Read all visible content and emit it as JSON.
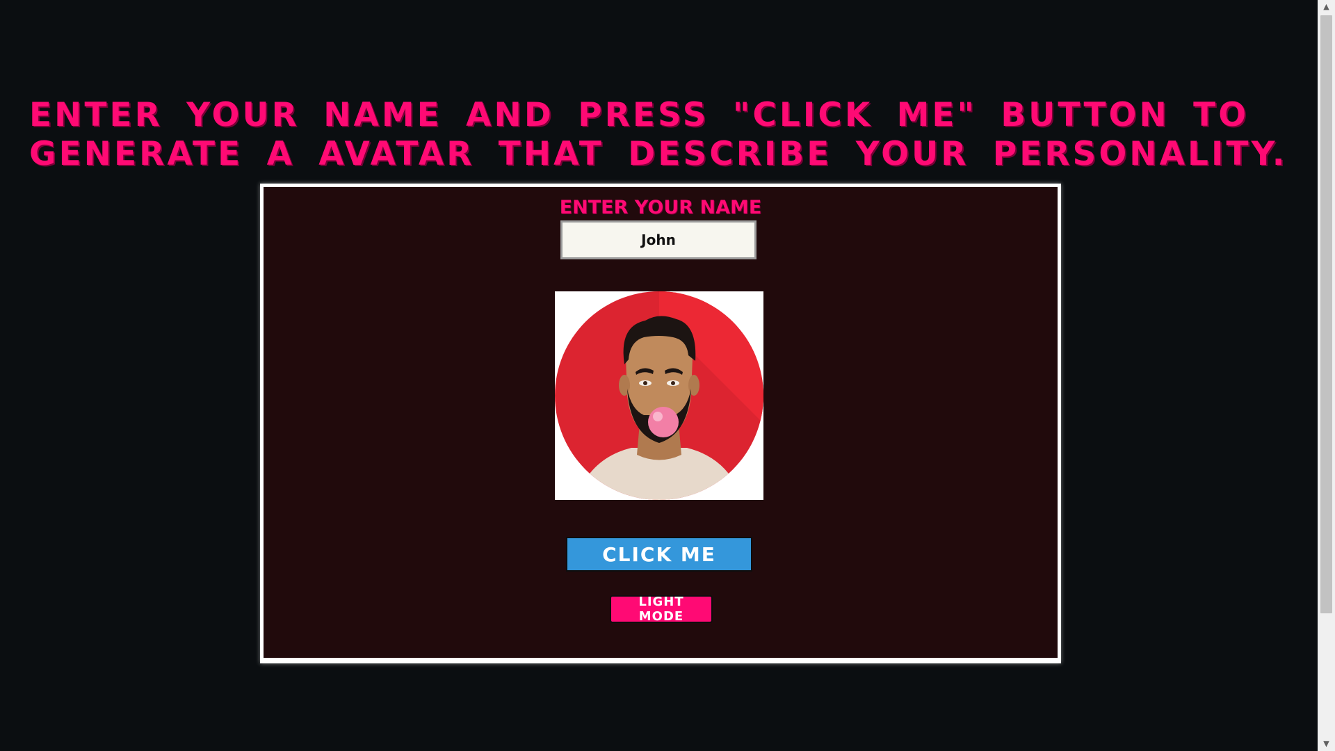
{
  "headline": "ENTER YOUR NAME AND PRESS \"CLICK ME\" BUTTON TO GENERATE A AVATAR THAT DESCRIBE YOUR PERSONALITY.",
  "form": {
    "name_label": "ENTER YOUR NAME",
    "name_value": "John"
  },
  "avatar": {
    "icon": "avatar-man-bubblegum-icon",
    "bg_color": "#e0262f"
  },
  "buttons": {
    "click_label": "CLICK ME",
    "light_mode_label": "LIGHT MODE"
  },
  "colors": {
    "accent_pink": "#ff0a74",
    "button_blue": "#3497db",
    "page_bg": "#0b0e11",
    "panel_bg": "#210a0c"
  },
  "scrollbar": {
    "up_icon": "arrow-up-icon",
    "down_icon": "arrow-down-icon"
  }
}
